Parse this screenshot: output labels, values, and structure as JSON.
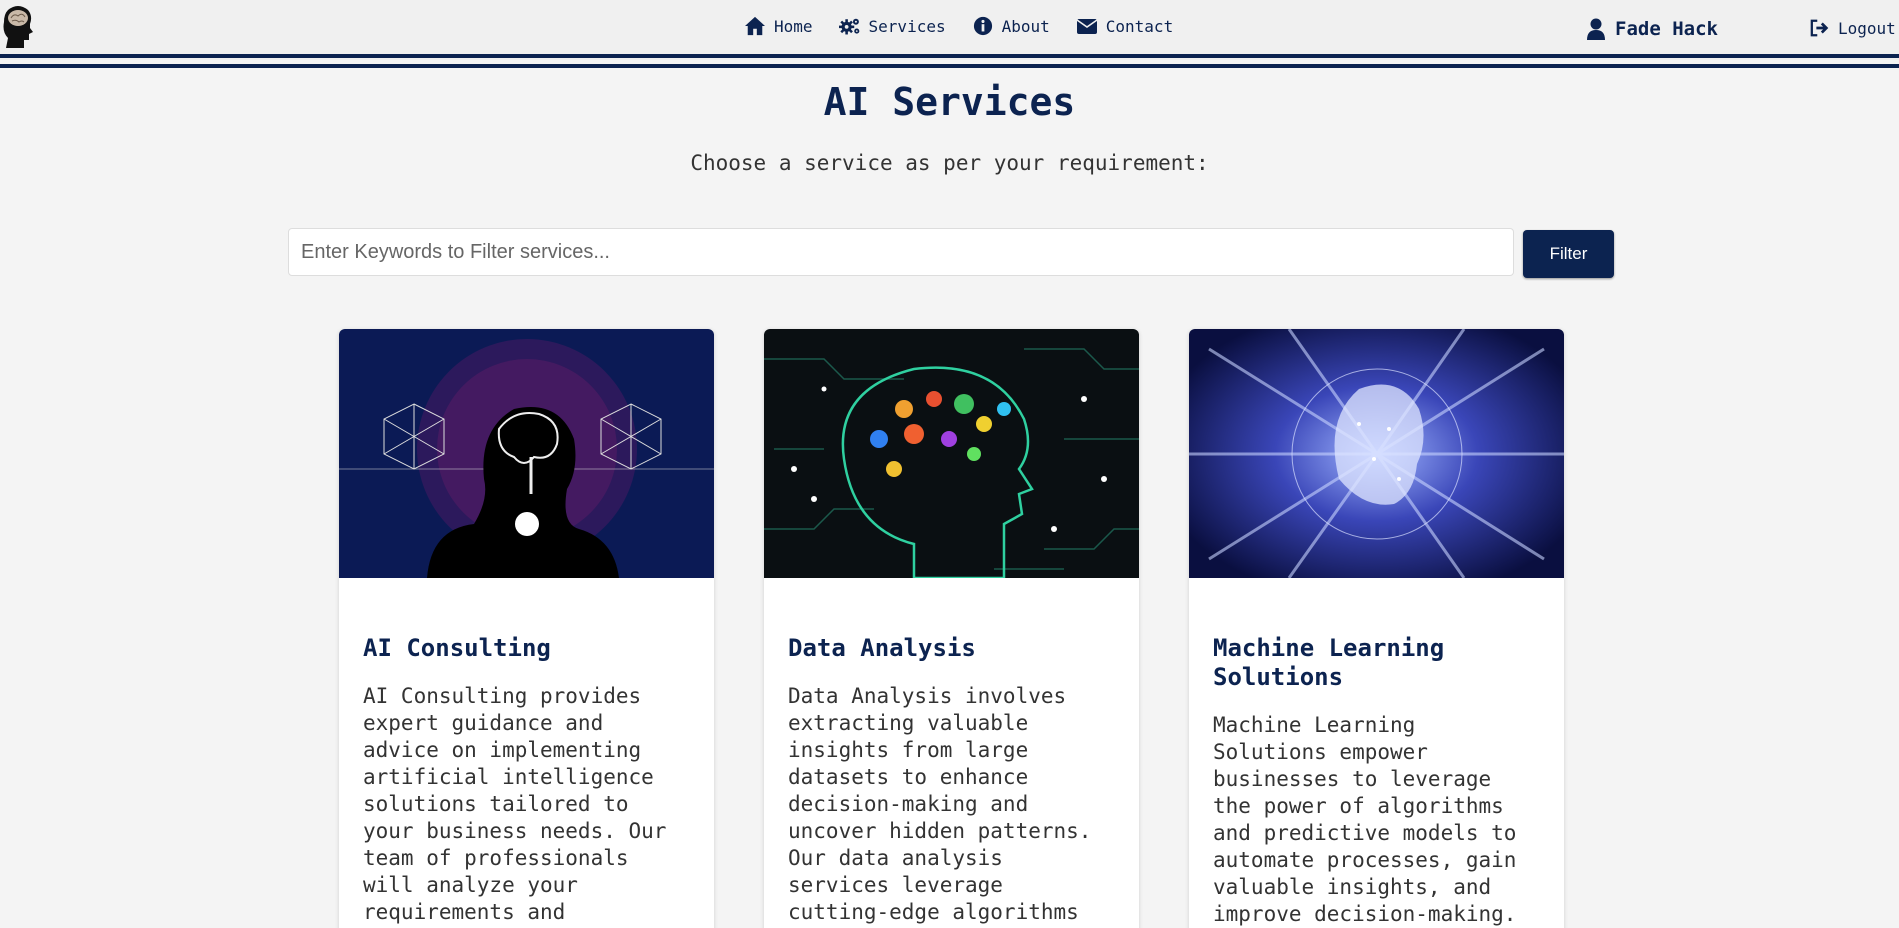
{
  "nav": {
    "items": [
      {
        "label": "Home",
        "icon": "home-icon"
      },
      {
        "label": "Services",
        "icon": "gears-icon"
      },
      {
        "label": "About",
        "icon": "info-icon"
      },
      {
        "label": "Contact",
        "icon": "envelope-icon"
      }
    ],
    "user_name": "Fade Hack",
    "logout_label": "Logout"
  },
  "page": {
    "title": "AI Services",
    "subtitle": "Choose a service as per your requirement:"
  },
  "search": {
    "placeholder": "Enter Keywords to Filter services...",
    "value": "",
    "button_label": "Filter"
  },
  "services": [
    {
      "title": "AI Consulting",
      "description": "AI Consulting provides expert guidance and advice on implementing artificial intelligence solutions tailored to your business needs. Our team of professionals will analyze your requirements and recommend the most"
    },
    {
      "title": "Data Analysis",
      "description": "Data Analysis involves extracting valuable insights from large datasets to enhance decision-making and uncover hidden patterns. Our data analysis services leverage cutting-edge algorithms and advanced"
    },
    {
      "title": "Machine Learning Solutions",
      "description": "Machine Learning Solutions empower businesses to leverage the power of algorithms and predictive models to automate processes, gain valuable insights, and improve decision-making. Our"
    }
  ],
  "colors": {
    "brand": "#0c2350",
    "background": "#f4f4f4"
  }
}
